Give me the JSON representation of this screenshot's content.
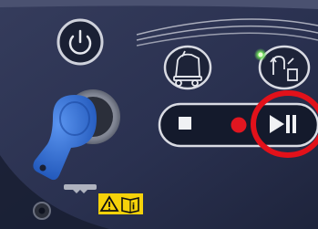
{
  "photo": {
    "subject": "control panel",
    "colors": {
      "panel": "#2a3150",
      "panel_dark": "#1b2236",
      "button_ring": "#d9dbe3",
      "record_dot": "#e01620",
      "power_led": "#6fe05a",
      "key_fob": "#2f6fd6",
      "annotation": "#e2111a",
      "warning_label": "#f5d20a"
    }
  },
  "buttons": {
    "power": {
      "icon": "power-icon"
    },
    "cleaning_mode": {
      "icon": "scrubber-machine-icon"
    },
    "tool_mode": {
      "icon": "hose-tool-icon"
    },
    "stop": {
      "icon": "stop-icon"
    },
    "record": {
      "icon": "record-icon"
    },
    "play_pause": {
      "icon": "play-pause-icon"
    }
  },
  "key": {
    "icon": "key-fob-icon"
  },
  "warning_label": {
    "icons": [
      "warning-triangle-icon",
      "read-manual-icon"
    ],
    "manual_glyph": "i"
  },
  "annotation": {
    "shape": "circle",
    "target": "play_pause"
  }
}
